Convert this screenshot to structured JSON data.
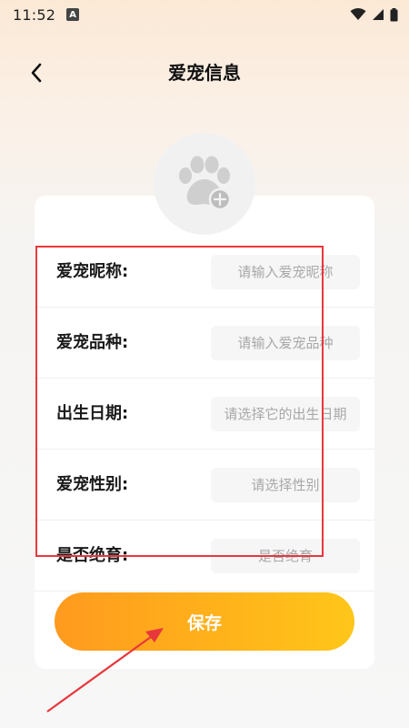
{
  "status_bar": {
    "time": "11:52",
    "notification_letter": "A"
  },
  "nav": {
    "title": "爱宠信息"
  },
  "form": {
    "rows": [
      {
        "label": "爱宠昵称:",
        "placeholder": "请输入爱宠昵称",
        "value": ""
      },
      {
        "label": "爱宠品种:",
        "placeholder": "请输入爱宠品种",
        "value": ""
      },
      {
        "label": "出生日期:",
        "placeholder": "请选择它的出生日期",
        "value": ""
      },
      {
        "label": "爱宠性别:",
        "placeholder": "请选择性别",
        "value": ""
      },
      {
        "label": "是否绝育:",
        "placeholder": "是否绝育",
        "value": ""
      }
    ]
  },
  "actions": {
    "save_label": "保存"
  },
  "colors": {
    "accent_start": "#ff9a1f",
    "accent_end": "#ffc61a",
    "annotation_red": "#e8373c"
  },
  "icons": {
    "back": "chevron-left-icon",
    "avatar": "paw-icon",
    "avatar_add": "plus-circle-icon",
    "wifi": "wifi-icon",
    "signal": "signal-icon",
    "battery": "battery-icon"
  }
}
